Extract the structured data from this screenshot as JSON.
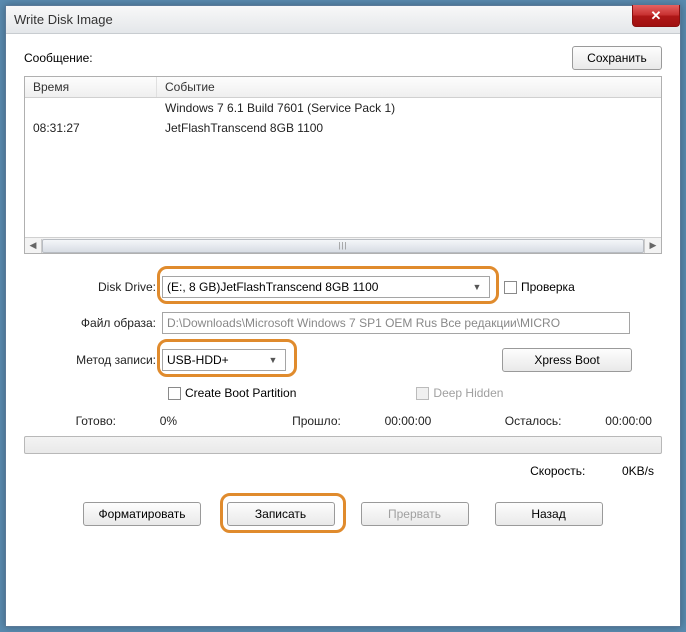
{
  "window": {
    "title": "Write Disk Image"
  },
  "labels": {
    "message": "Сообщение:",
    "save": "Сохранить",
    "time_col": "Время",
    "event_col": "Событие",
    "disk_drive": "Disk Drive:",
    "image_file": "Файл образа:",
    "write_method": "Метод записи:",
    "check": "Проверка",
    "xpress_boot": "Xpress Boot",
    "create_boot_partition": "Create Boot Partition",
    "deep_hidden": "Deep Hidden",
    "ready": "Готово:",
    "elapsed": "Прошло:",
    "remaining": "Осталось:",
    "speed": "Скорость:",
    "format": "Форматировать",
    "write": "Записать",
    "abort": "Прервать",
    "back": "Назад"
  },
  "log": [
    {
      "time": "",
      "event": "Windows 7 6.1 Build 7601 (Service Pack 1)"
    },
    {
      "time": "08:31:27",
      "event": "JetFlashTranscend 8GB  1100"
    }
  ],
  "disk_drive_value": "(E:, 8 GB)JetFlashTranscend 8GB  1100",
  "image_file_value": "D:\\Downloads\\Microsoft Windows 7 SP1 OEM Rus Все редакции\\MICRO",
  "write_method_value": "USB-HDD+",
  "progress_pct": "0%",
  "elapsed_time": "00:00:00",
  "remaining_time": "00:00:00",
  "speed_value": "0KB/s",
  "checkboxes": {
    "check": false,
    "create_boot_partition": false,
    "deep_hidden": false
  }
}
